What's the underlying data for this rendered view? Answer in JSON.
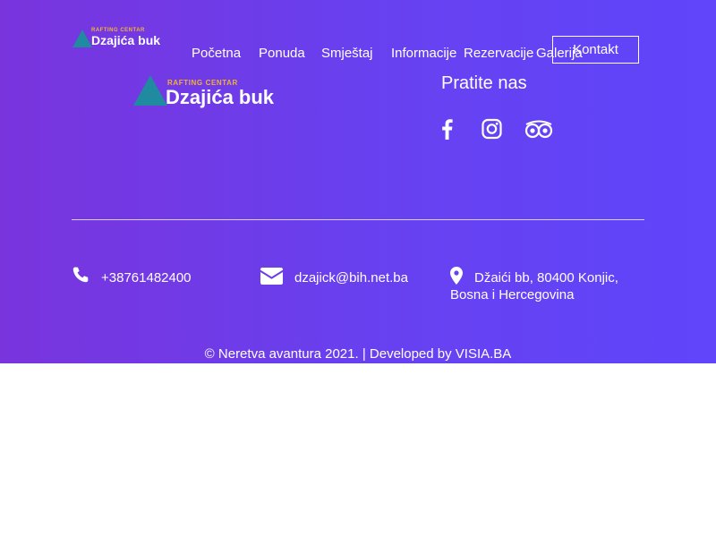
{
  "brand": {
    "tagline": "RAFTING CENTAR",
    "name": "Dzajića buk",
    "logo_color": "#1f8aa0",
    "tagline_color": "#f2b233"
  },
  "nav": {
    "items": [
      "Početna",
      "Ponuda",
      "Smještaj",
      "Informacije",
      "Rezervacije",
      "Galerija"
    ],
    "cta": "Kontakt"
  },
  "social": {
    "heading": "Pratite nas",
    "icons": [
      "facebook-icon",
      "instagram-icon",
      "tripadvisor-icon"
    ]
  },
  "contact": {
    "phone": "+38761482400",
    "email": "dzajick@bih.net.ba",
    "address_line1": "Džaići bb, 80400 Konjic,",
    "address_line2": "Bosna i Hercegovina"
  },
  "footer": {
    "copyright": "© Neretva avantura 2021. | Developed by VISIA.BA"
  },
  "colors": {
    "gradient_start": "#7934dd",
    "gradient_end": "#6045fb",
    "text": "#ffffff"
  }
}
